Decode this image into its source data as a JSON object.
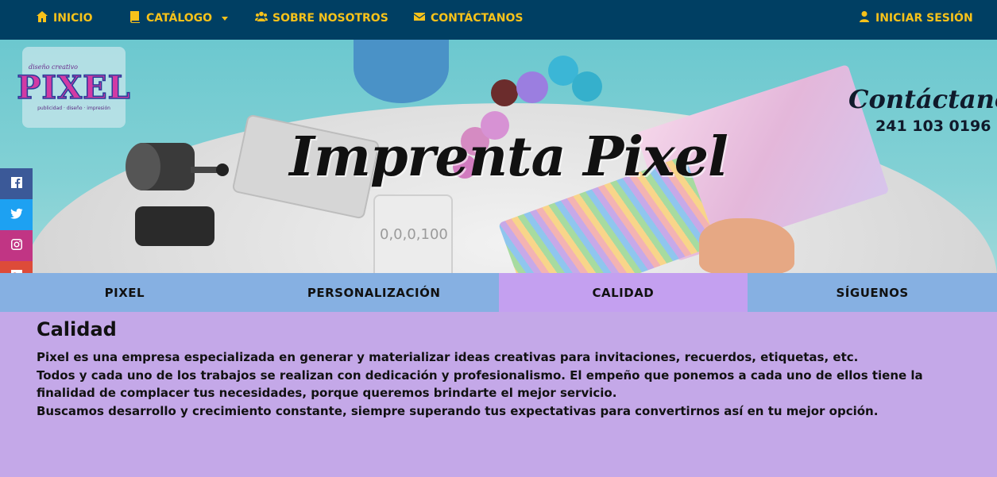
{
  "nav": {
    "items": [
      {
        "label": "INICIO",
        "icon": "home-icon"
      },
      {
        "label": "CATÁLOGO",
        "icon": "book-icon"
      },
      {
        "label": "SOBRE NOSOTROS",
        "icon": "users-icon"
      },
      {
        "label": "CONTÁCTANOS",
        "icon": "envelope-icon"
      }
    ],
    "login": {
      "label": "INICIAR SESIÓN",
      "icon": "user-icon"
    }
  },
  "hero": {
    "logo": {
      "top": "diseño creativo",
      "main": "PIXEL",
      "sub": "publicidad · diseño · impresión"
    },
    "title": "Imprenta Pixel",
    "contact_script": "Contáctanos",
    "phone": "241 103 0196",
    "mug_text": "0,0,0,100"
  },
  "social": [
    {
      "name": "facebook",
      "icon": "facebook-icon",
      "color": "#3b5998"
    },
    {
      "name": "twitter",
      "icon": "twitter-icon",
      "color": "#1da1f2"
    },
    {
      "name": "instagram",
      "icon": "instagram-icon",
      "color": "#c13584"
    },
    {
      "name": "google-plus",
      "icon": "google-plus-icon",
      "color": "#dd4b39"
    }
  ],
  "tabs": [
    {
      "label": "PIXEL",
      "active": false
    },
    {
      "label": "PERSONALIZACIÓN",
      "active": false
    },
    {
      "label": "CALIDAD",
      "active": true
    },
    {
      "label": "SÍGUENOS",
      "active": false
    }
  ],
  "content": {
    "heading": "Calidad",
    "paragraphs": [
      "Pixel es una empresa especializada en generar y materializar ideas creativas para invitaciones, recuerdos, etiquetas, etc.",
      "Todos y cada uno de los trabajos se realizan con dedicación y profesionalismo. El empeño que ponemos a cada uno de ellos tiene la finalidad de complacer tus necesidades, porque queremos brindarte el mejor servicio.",
      "Buscamos desarrollo y crecimiento constante, siempre superando tus expectativas para convertirnos así en tu mejor opción."
    ]
  },
  "colors": {
    "navbar": "#003f63",
    "nav_text": "#f7c21a",
    "tab": "#86b0e2",
    "tab_active": "#c4a0f0",
    "content_bg": "#c4a8e8"
  }
}
